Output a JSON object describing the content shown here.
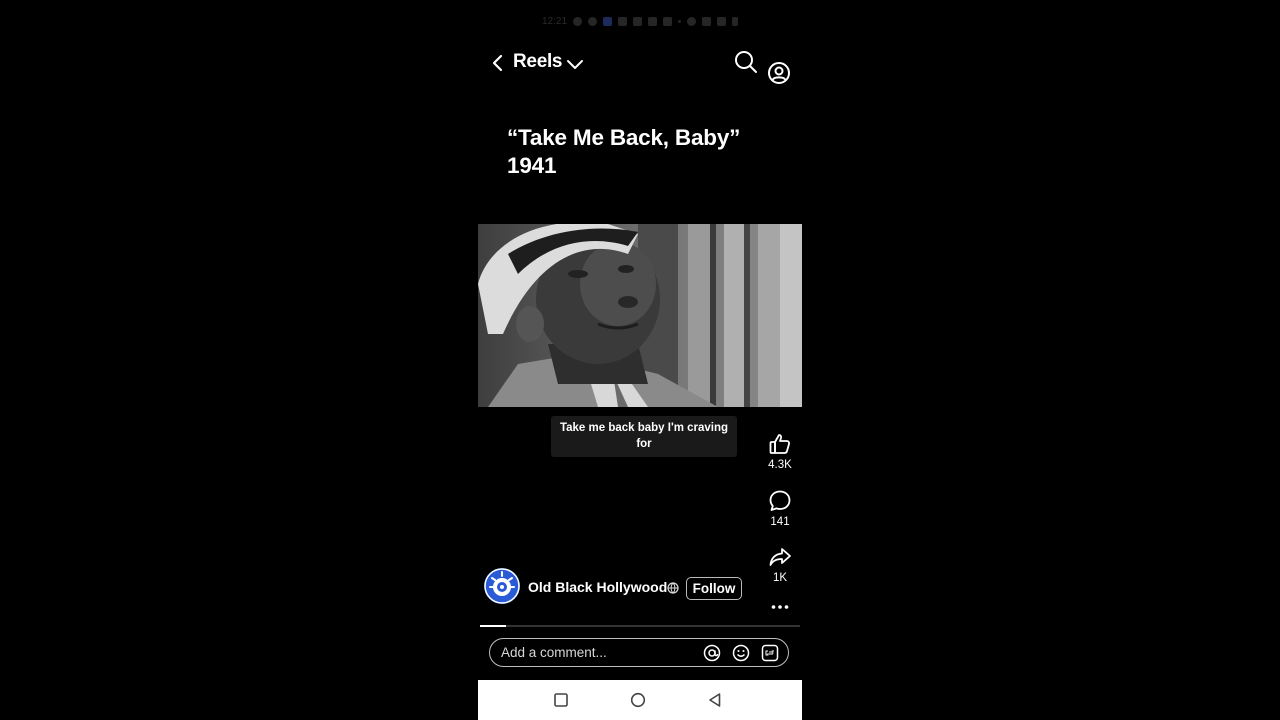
{
  "status_bar": {
    "time": "12:21"
  },
  "header": {
    "back_icon": "chevron-left-icon",
    "title": "Reels",
    "dropdown_icon": "chevron-down-icon",
    "search_icon": "search-icon",
    "profile_icon": "user-circle-icon"
  },
  "video": {
    "title": "“Take Me Back, Baby”\n1941",
    "caption": "Take me back baby I'm craving for",
    "progress": 0.08
  },
  "actions": [
    {
      "icon": "thumbs-up-icon",
      "count": "4.3K"
    },
    {
      "icon": "comment-icon",
      "count": "141"
    },
    {
      "icon": "share-icon",
      "count": "1K"
    }
  ],
  "more_icon": "more-horizontal-icon",
  "account": {
    "name": "Old Black Hollywood",
    "verified_icon": "globe-icon",
    "follow_label": "Follow",
    "avatar_color": "#2a5bd7"
  },
  "comment_bar": {
    "placeholder": "Add a comment...",
    "icons": [
      "at-icon",
      "emoji-icon",
      "gif-icon"
    ]
  },
  "nav_bar": {
    "buttons": [
      "recents-square-icon",
      "home-circle-icon",
      "back-triangle-icon"
    ]
  },
  "colors": {
    "background": "#000000",
    "text": "#ffffff",
    "nav_background": "#ffffff"
  }
}
